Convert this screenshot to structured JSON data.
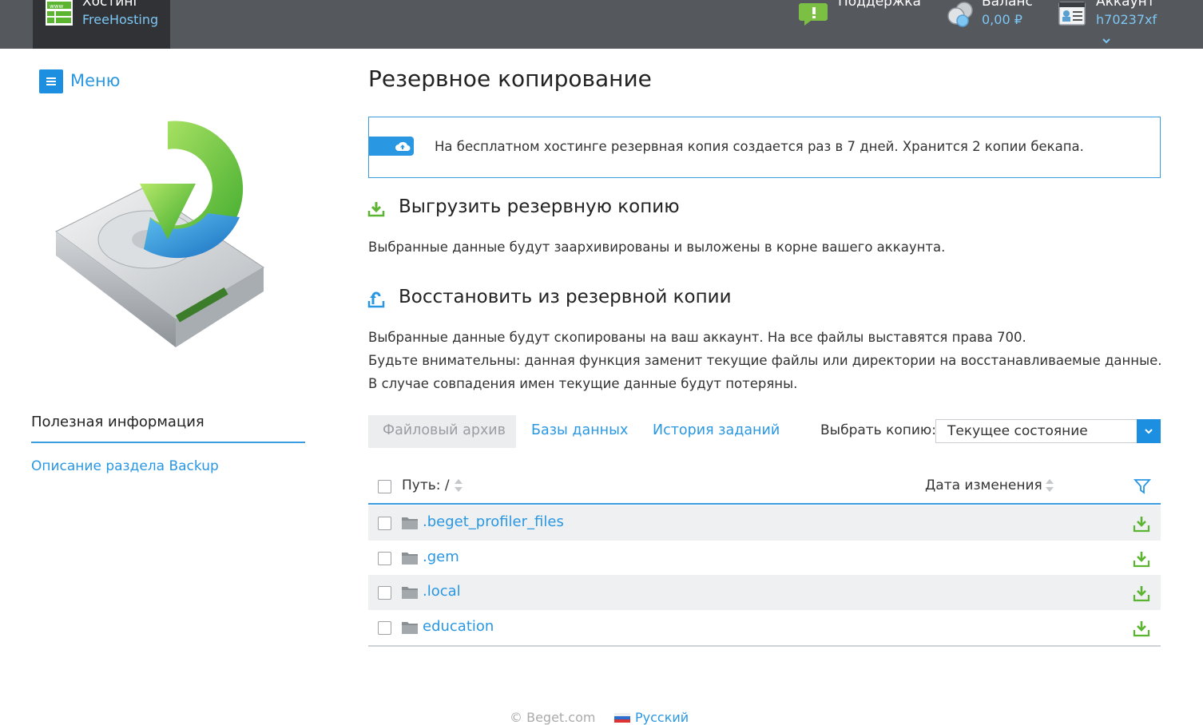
{
  "topbar": {
    "hosting_title": "Хостинг",
    "hosting_sub": "FreeHosting",
    "support_label": "Поддержка",
    "balance_label": "Баланс",
    "balance_value": "0,00 ₽",
    "account_label": "Аккаунт",
    "account_value": "h70237xf"
  },
  "sidebar": {
    "menu_label": "Меню",
    "useful_title": "Полезная информация",
    "useful_link": "Описание раздела Backup"
  },
  "main": {
    "title": "Резервное копирование",
    "info_text": "На бесплатном хостинге резервная копия создается раз в 7 дней. Хранится 2 копии бекапа.",
    "export_title": "Выгрузить резервную копию",
    "export_desc": "Выбранные данные будут заархивированы и выложены в корне вашего аккаунта.",
    "restore_title": "Восстановить из резервной копии",
    "restore_desc_1": "Выбранные данные будут скопированы на ваш аккаунт. На все файлы выставятся права 700.",
    "restore_desc_2": "Будьте внимательны: данная функция заменит текущие файлы или директории на восстанавливаемые данные.",
    "restore_desc_3": "В случае совпадения имен текущие данные будут потеряны."
  },
  "tabs": [
    {
      "label": "Файловый архив",
      "active": true
    },
    {
      "label": "Базы данных",
      "active": false
    },
    {
      "label": "История заданий",
      "active": false
    }
  ],
  "select": {
    "label": "Выбрать копию:",
    "value": "Текущее состояние"
  },
  "table": {
    "col_path": "Путь: /",
    "col_date": "Дата изменения",
    "rows": [
      {
        "name": ".beget_profiler_files"
      },
      {
        "name": ".gem"
      },
      {
        "name": ".local"
      },
      {
        "name": "education"
      }
    ]
  },
  "footer": {
    "copyright": "© Beget.com",
    "language": "Русский"
  },
  "colors": {
    "accent": "#2a97e2",
    "topbar": "#55585d",
    "download_green": "#5cb531"
  }
}
